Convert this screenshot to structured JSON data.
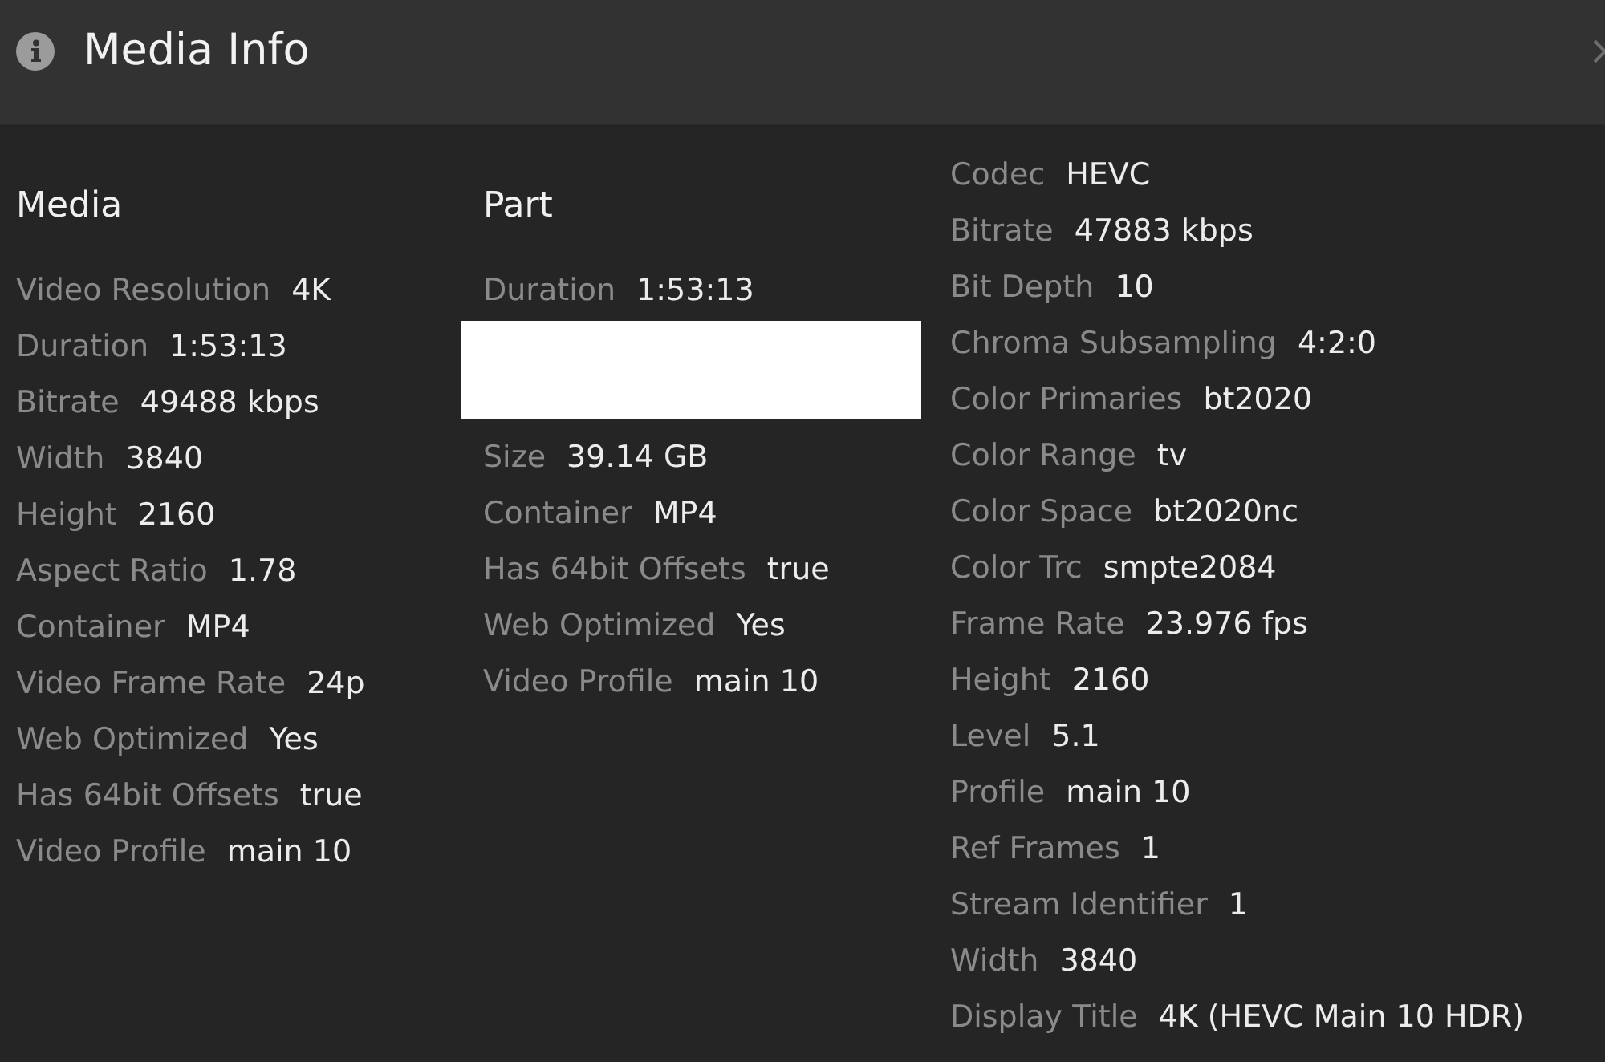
{
  "header": {
    "title": "Media Info"
  },
  "media": {
    "heading": "Media",
    "fields": [
      {
        "label": "Video Resolution",
        "value": "4K"
      },
      {
        "label": "Duration",
        "value": "1:53:13"
      },
      {
        "label": "Bitrate",
        "value": "49488 kbps"
      },
      {
        "label": "Width",
        "value": "3840"
      },
      {
        "label": "Height",
        "value": "2160"
      },
      {
        "label": "Aspect Ratio",
        "value": "1.78"
      },
      {
        "label": "Container",
        "value": "MP4"
      },
      {
        "label": "Video Frame Rate",
        "value": "24p"
      },
      {
        "label": "Web Optimized",
        "value": "Yes"
      },
      {
        "label": "Has 64bit Offsets",
        "value": "true"
      },
      {
        "label": "Video Profile",
        "value": "main 10"
      }
    ]
  },
  "part": {
    "heading": "Part",
    "fields": [
      {
        "kind": "field",
        "label": "Duration",
        "value": "1:53:13"
      },
      {
        "kind": "redaction"
      },
      {
        "kind": "field",
        "label": "Size",
        "value": "39.14 GB"
      },
      {
        "kind": "field",
        "label": "Container",
        "value": "MP4"
      },
      {
        "kind": "field",
        "label": "Has 64bit Offsets",
        "value": "true"
      },
      {
        "kind": "field",
        "label": "Web Optimized",
        "value": "Yes"
      },
      {
        "kind": "field",
        "label": "Video Profile",
        "value": "main 10"
      }
    ]
  },
  "stream": {
    "fields": [
      {
        "label": "Codec",
        "value": "HEVC"
      },
      {
        "label": "Bitrate",
        "value": "47883 kbps"
      },
      {
        "label": "Bit Depth",
        "value": "10"
      },
      {
        "label": "Chroma Subsampling",
        "value": "4:2:0"
      },
      {
        "label": "Color Primaries",
        "value": "bt2020"
      },
      {
        "label": "Color Range",
        "value": "tv"
      },
      {
        "label": "Color Space",
        "value": "bt2020nc"
      },
      {
        "label": "Color Trc",
        "value": "smpte2084"
      },
      {
        "label": "Frame Rate",
        "value": "23.976 fps"
      },
      {
        "label": "Height",
        "value": "2160"
      },
      {
        "label": "Level",
        "value": "5.1"
      },
      {
        "label": "Profile",
        "value": "main 10"
      },
      {
        "label": "Ref Frames",
        "value": "1"
      },
      {
        "label": "Stream Identifier",
        "value": "1"
      },
      {
        "label": "Width",
        "value": "3840"
      },
      {
        "label": "Display Title",
        "value": "4K (HEVC Main 10 HDR)"
      }
    ]
  }
}
